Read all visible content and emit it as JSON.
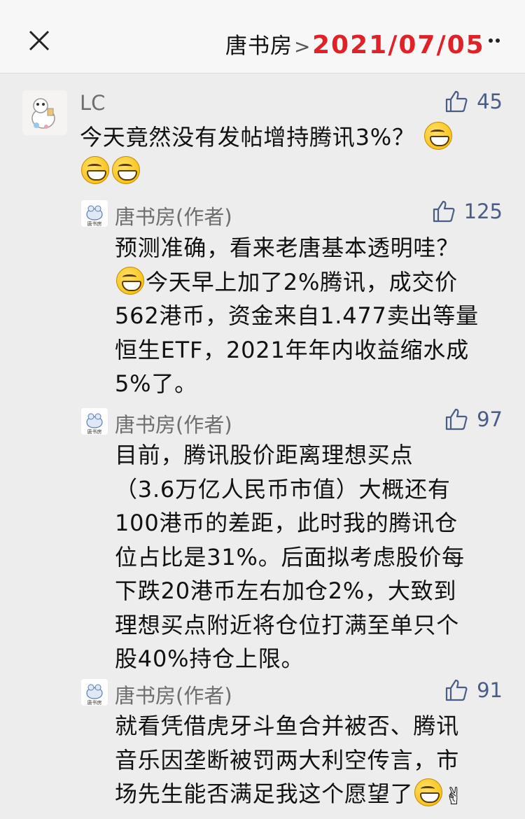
{
  "header": {
    "title": "唐书房",
    "chevron": ">",
    "date": "2021/07/05"
  },
  "icons": {
    "close": "close-icon",
    "more": "more-dots-icon",
    "like": "thumbs-up-icon"
  },
  "colors": {
    "date": "#e02127",
    "like_count": "#4a5d84",
    "username": "#6e6e6e"
  },
  "comment": {
    "user": "LC",
    "likes": "45",
    "text": "今天竟然没有发帖增持腾讯3%？"
  },
  "replies": [
    {
      "user": "唐书房(作者)",
      "avatar_label": "唐书房",
      "likes": "125",
      "lines": [
        "预测准确，看来老唐基本透明哇？",
        "今天早上加了2%腾讯，成交价",
        "562港币，资金来自1.477卖出等量",
        "恒生ETF，2021年年内收益缩水成",
        "5%了。"
      ]
    },
    {
      "user": "唐书房(作者)",
      "avatar_label": "唐书房",
      "likes": "97",
      "lines": [
        "目前，腾讯股价距离理想买点",
        "（3.6万亿人民币市值）大概还有",
        "100港币的差距，此时我的腾讯仓",
        "位占比是31%。后面拟考虑股价每",
        "下跌20港币左右加仓2%，大致到",
        "理想买点附近将仓位打满至单只个",
        "股40%持仓上限。"
      ]
    },
    {
      "user": "唐书房(作者)",
      "avatar_label": "唐书房",
      "likes": "91",
      "lines": [
        "就看凭借虎牙斗鱼合并被否、腾讯",
        "音乐因垄断被罚两大利空传言，市",
        "场先生能否满足我这个愿望了"
      ]
    }
  ]
}
